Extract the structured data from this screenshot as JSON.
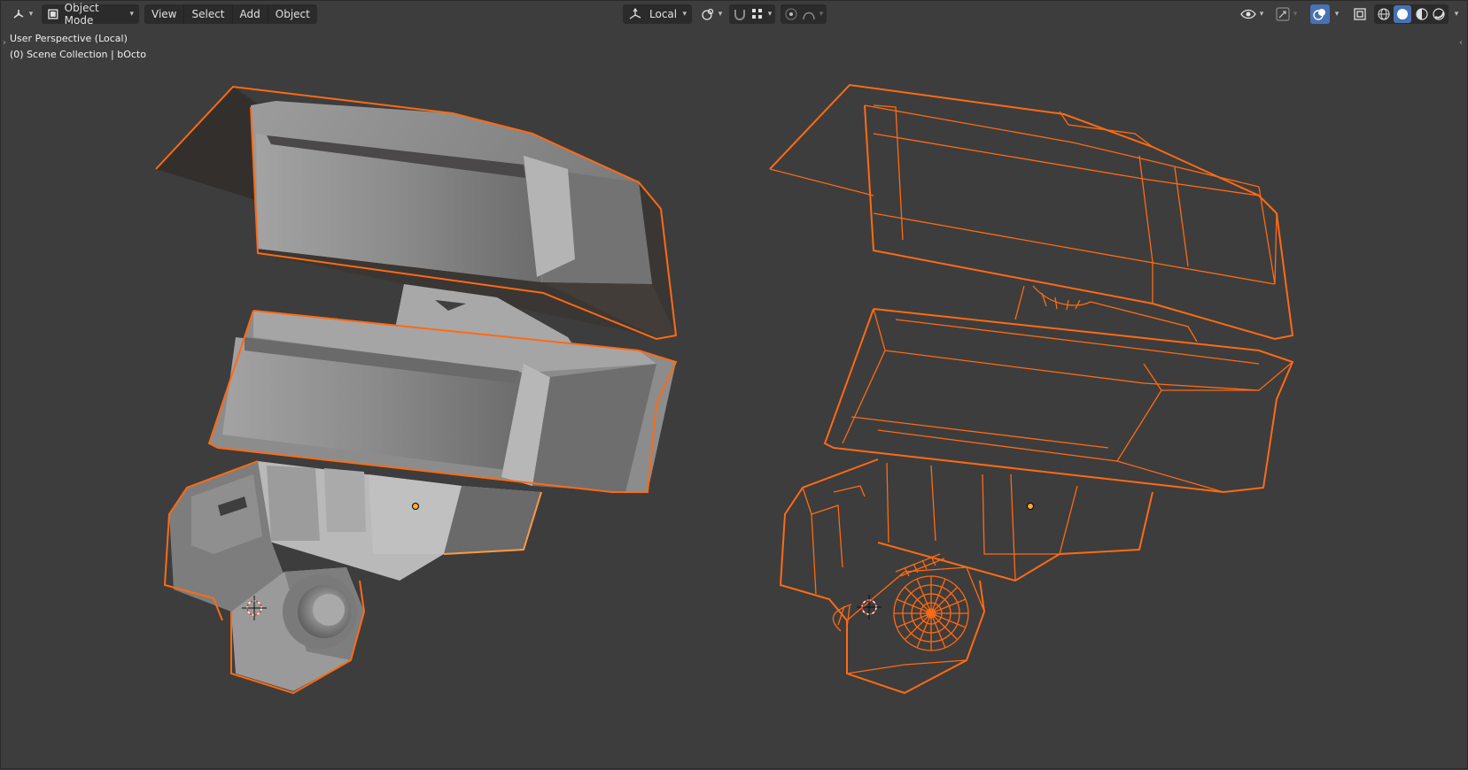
{
  "header": {
    "mode": "Object Mode",
    "menus": [
      "View",
      "Select",
      "Add",
      "Object"
    ],
    "orientation": "Local",
    "icons": {
      "editor_type": "axes-icon",
      "mode": "cube-object-icon",
      "orientation": "transform-orientation-icon",
      "pivot": "pivot-point-icon",
      "snap": "magnet-icon",
      "snap_target": "snap-grid-icon",
      "proportional": "proportional-edit-icon",
      "falloff": "falloff-curve-icon",
      "visibility": "eye-icon",
      "gizmo": "gizmo-icon",
      "overlays": "overlays-icon",
      "xray": "xray-icon",
      "shading_wire": "wireframe-shading-icon",
      "shading_solid": "solid-shading-icon",
      "shading_material": "material-shading-icon",
      "shading_render": "rendered-shading-icon"
    }
  },
  "overlay": {
    "view_name": "User Perspective (Local)",
    "collection": "(0) Scene Collection | bOcto"
  },
  "colors": {
    "background": "#3d3d3d",
    "header_button": "#2b2b2b",
    "active_button": "#4772b3",
    "selection_outline": "#ff6a13",
    "mesh_solid": "#8a8a8a",
    "origin_dot": "#ffaa33"
  }
}
